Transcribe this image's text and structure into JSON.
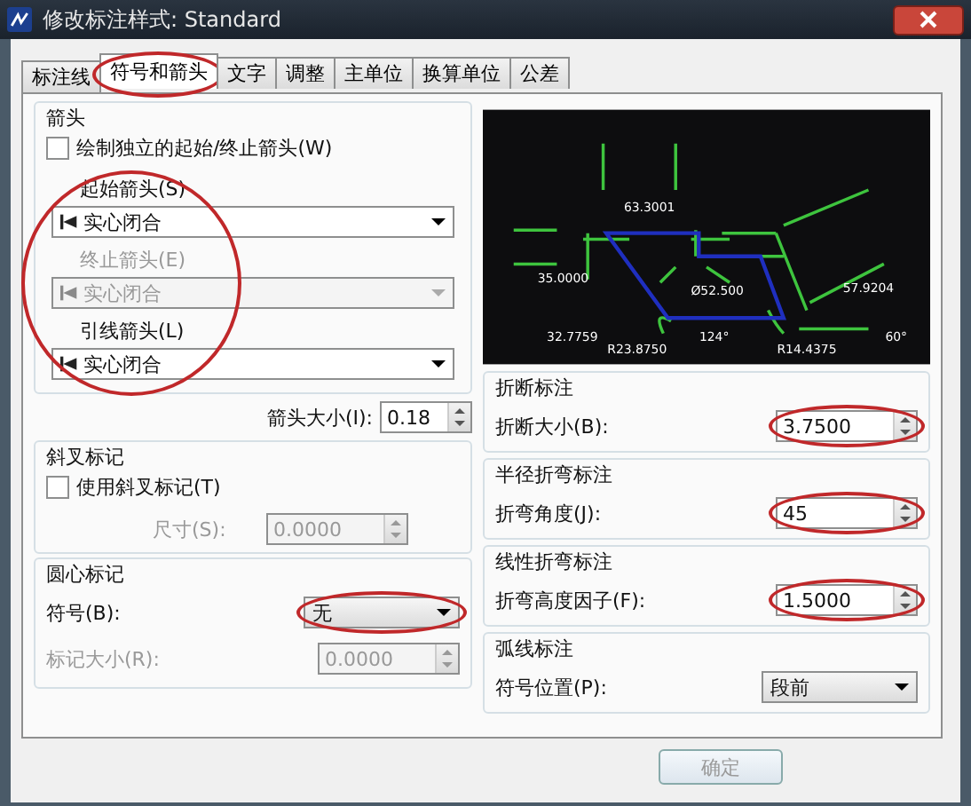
{
  "window": {
    "title": "修改标注样式: Standard"
  },
  "tabs": [
    {
      "label": "标注线",
      "selected": false,
      "circled": false
    },
    {
      "label": "符号和箭头",
      "selected": true,
      "circled": true
    },
    {
      "label": "文字",
      "selected": false,
      "circled": false
    },
    {
      "label": "调整",
      "selected": false,
      "circled": false
    },
    {
      "label": "主单位",
      "selected": false,
      "circled": false
    },
    {
      "label": "换算单位",
      "selected": false,
      "circled": false
    },
    {
      "label": "公差",
      "selected": false,
      "circled": false
    }
  ],
  "arrows": {
    "title": "箭头",
    "circled": true,
    "checkbox": {
      "label": "绘制独立的起始/终止箭头(W)",
      "checked": false
    },
    "dropdowns": [
      {
        "label": "起始箭头(S)",
        "value": "实心闭合",
        "disabled": false
      },
      {
        "label": "终止箭头(E)",
        "value": "实心闭合",
        "disabled": true
      },
      {
        "label": "引线箭头(L)",
        "value": "实心闭合",
        "disabled": false
      }
    ],
    "size": {
      "label": "箭头大小(I):",
      "value": "0.18"
    }
  },
  "oblique": {
    "title": "斜叉标记",
    "checkbox": {
      "label": "使用斜叉标记(T)",
      "checked": false
    },
    "size": {
      "label": "尺寸(S):",
      "value": "0.0000",
      "disabled": true
    }
  },
  "center": {
    "title": "圆心标记",
    "symbol": {
      "label": "符号(B):",
      "value": "无",
      "circled": true
    },
    "size": {
      "label": "标记大小(R):",
      "value": "0.0000",
      "disabled": true
    }
  },
  "preview_labels": [
    "63.3001",
    "35.0000",
    "Ø52.500",
    "R23.8750",
    "R14.4375",
    "32.7759",
    "124°",
    "57.9204",
    "60°"
  ],
  "right_groups": [
    {
      "title": "折断标注",
      "label": "折断大小(B):",
      "value": "3.7500",
      "kind": "spinner",
      "circled": true
    },
    {
      "title": "半径折弯标注",
      "label": "折弯角度(J):",
      "value": "45",
      "kind": "spinner",
      "circled": true
    },
    {
      "title": "线性折弯标注",
      "label": "折弯高度因子(F):",
      "value": "1.5000",
      "kind": "spinner",
      "circled": true
    },
    {
      "title": "弧线标注",
      "label": "符号位置(P):",
      "value": "段前",
      "kind": "dropdown",
      "circled": false
    }
  ],
  "buttons": [
    {
      "label": "确定",
      "disabled": true
    }
  ]
}
